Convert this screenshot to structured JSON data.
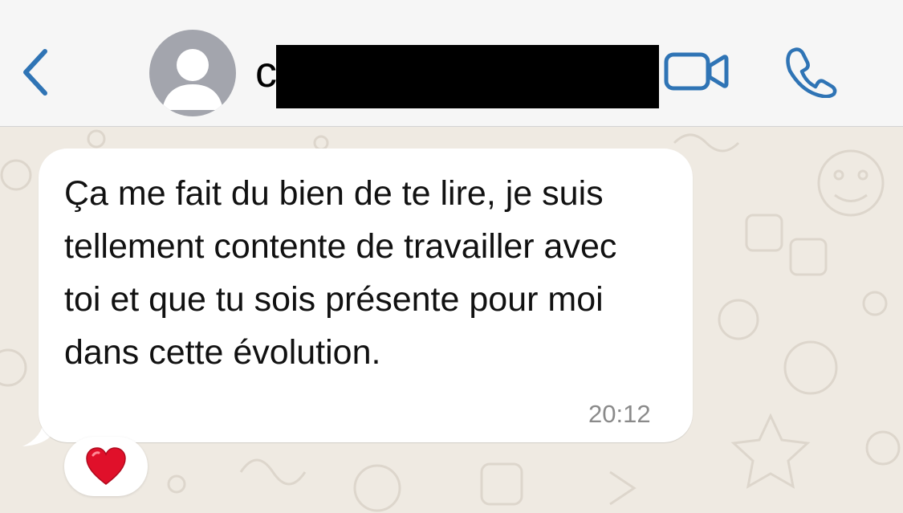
{
  "header": {
    "contact_name": "c",
    "back_icon": "chevron-left-icon",
    "avatar_icon": "person-icon",
    "video_icon": "video-camera-icon",
    "call_icon": "phone-icon",
    "accent_color": "#2f74b5",
    "avatar_color": "#a3a5ad"
  },
  "message": {
    "text": "Ça me fait du bien de te lire, je suis tellement contente de travailler avec toi et que tu sois présente pour moi dans cette évolution.",
    "time": "20:12",
    "reaction_icon": "red-heart-icon"
  },
  "chat": {
    "background_color": "#efeae2",
    "bubble_color": "#ffffff"
  }
}
